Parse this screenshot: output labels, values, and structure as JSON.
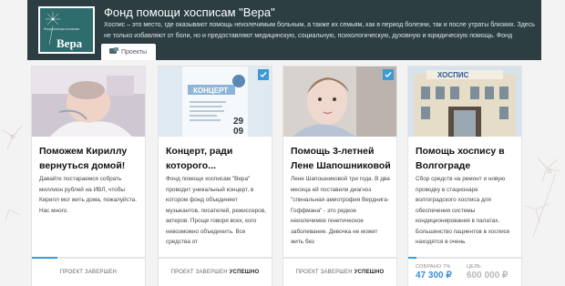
{
  "org": {
    "logo_word": "Вера",
    "logo_sub": "Фонд помощи хосписам",
    "title": "Фонд помощи хосписам \"Вера\"",
    "description": "Хоспис – это место, где оказывают помощь неизлечимым больным, а также их семьям, как в период болезни, так и после утраты близких. Здесь не только избавляют от боли, но и предоставляют медицинскую, социальную, психологическую, духовную и юридическую помощь. Фонд помощи"
  },
  "tabs": [
    {
      "label": "Проекты",
      "icon": "projects-icon"
    }
  ],
  "accent_color": "#3c9ad6",
  "cards": [
    {
      "title": "Поможем Кириллу вернуться домой!",
      "text": "Давайте постараемся собрать миллион рублей на ИВЛ, чтобы Кирилл мог жить дома, пожалуйста. Нас много.",
      "status": "ПРОЕКТ ЗАВЕРШЕН",
      "status_extra": "",
      "checked": false
    },
    {
      "title": "Концерт, ради которого...",
      "text": "Фонд помощи хосписам \"Вера\" проводит уникальный концерт, в котором фонд объединяет музыкантов, писателей, режиссеров, актеров. Проще говоря всех, кого невозможно объединить. Все средства от",
      "status": "ПРОЕКТ ЗАВЕРШЕН",
      "status_extra": "УСПЕШНО",
      "checked": true,
      "poster": {
        "word": "КОНЦЕРТ",
        "day": "29",
        "month": "09"
      }
    },
    {
      "title": "Помощь 3-летней Лене Шапошниковой",
      "text": "Лене Шапошниковой три года. В два месяца ей поставили диагноз \"спинальная амиотрофия Верднига-Гоффмана\" - это редкое неизлечимое генетическое заболевание. Девочка не может жить без",
      "status": "ПРОЕКТ ЗАВЕРШЕН",
      "status_extra": "УСПЕШНО",
      "checked": true
    },
    {
      "title": "Помощь хоспису в Волгограде",
      "text": "Сбор средств на ремонт и новую проводку в стационаре волгоградского хосписа для обеспечения системы кондиционирования в палатах. Большинство пациентов в хосписе находятся в очень",
      "checked": false,
      "sign": "ХОСПИС",
      "funding": {
        "collected_label": "СОБРАНО 7%",
        "collected_value": "47 300 ₽",
        "goal_label": "ЦЕЛЬ",
        "goal_value": "600 000 ₽",
        "percent": 7
      }
    }
  ]
}
